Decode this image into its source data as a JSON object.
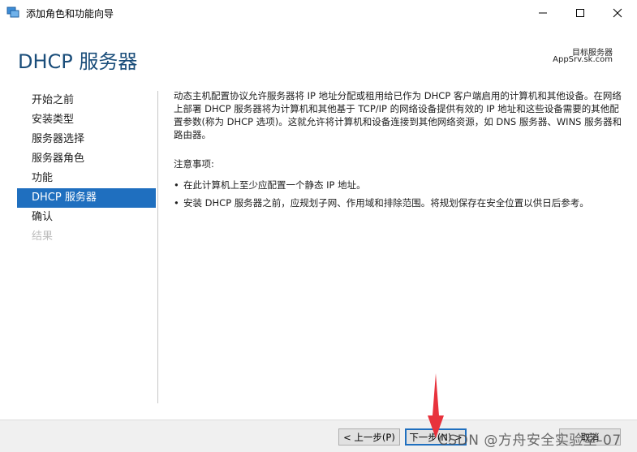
{
  "window": {
    "title": "添加角色和功能向导"
  },
  "header": {
    "page_title": "DHCP 服务器",
    "dest_label": "目标服务器",
    "dest_server": "AppSrv.sk.com"
  },
  "nav": {
    "items": [
      {
        "label": "开始之前",
        "state": "normal"
      },
      {
        "label": "安装类型",
        "state": "normal"
      },
      {
        "label": "服务器选择",
        "state": "normal"
      },
      {
        "label": "服务器角色",
        "state": "normal"
      },
      {
        "label": "功能",
        "state": "normal"
      },
      {
        "label": "DHCP 服务器",
        "state": "active"
      },
      {
        "label": "确认",
        "state": "normal"
      },
      {
        "label": "结果",
        "state": "disabled"
      }
    ]
  },
  "content": {
    "description": "动态主机配置协议允许服务器将 IP 地址分配或租用给已作为 DHCP 客户端启用的计算机和其他设备。在网络上部署 DHCP 服务器将为计算机和其他基于 TCP/IP 的网络设备提供有效的 IP 地址和这些设备需要的其他配置参数(称为 DHCP 选项)。这就允许将计算机和设备连接到其他网络资源，如 DNS 服务器、WINS 服务器和路由器。",
    "notes_heading": "注意事项:",
    "notes": [
      "在此计算机上至少应配置一个静态 IP 地址。",
      "安装 DHCP 服务器之前，应规划子网、作用域和排除范围。将规划保存在安全位置以供日后参考。"
    ]
  },
  "footer": {
    "prev_label": "< 上一步(P)",
    "next_label": "下一步(N) >",
    "cancel_label": "取消"
  },
  "overlay": {
    "watermark": "CSDN @方舟安全实验室-07",
    "arrow_color": "#e8323c"
  }
}
